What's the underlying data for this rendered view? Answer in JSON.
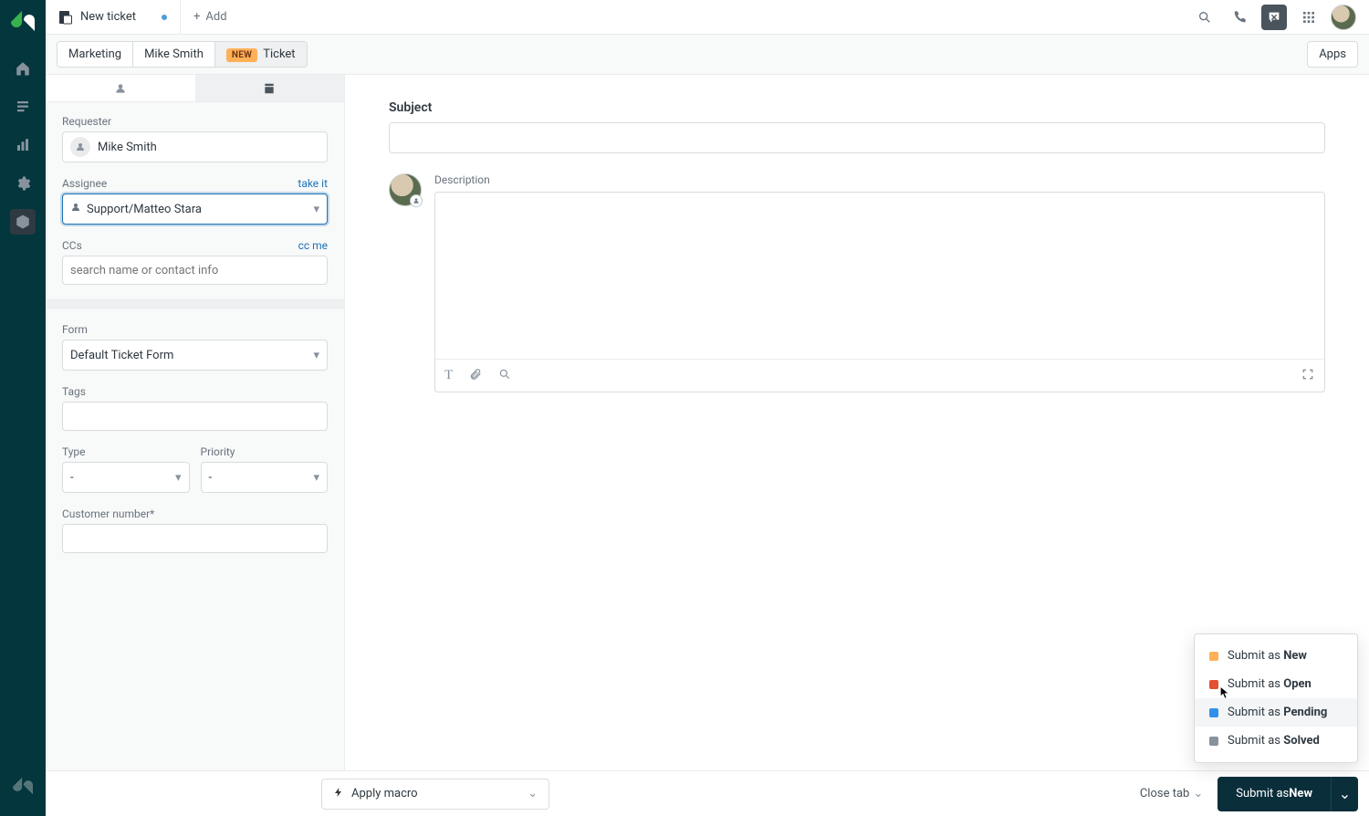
{
  "tabs": {
    "new_ticket_label": "New ticket",
    "add_label": "Add"
  },
  "breadcrumb": {
    "org": "Marketing",
    "user": "Mike Smith",
    "new_badge": "NEW",
    "ticket_label": "Ticket",
    "apps_btn": "Apps"
  },
  "sidebar": {
    "requester_label": "Requester",
    "requester_value": "Mike Smith",
    "assignee_label": "Assignee",
    "assignee_link": "take it",
    "assignee_value": "Support/Matteo Stara",
    "ccs_label": "CCs",
    "ccs_link": "cc me",
    "ccs_placeholder": "search name or contact info",
    "form_label": "Form",
    "form_value": "Default Ticket Form",
    "tags_label": "Tags",
    "type_label": "Type",
    "type_value": "-",
    "priority_label": "Priority",
    "priority_value": "-",
    "customer_number_label": "Customer number*"
  },
  "editor": {
    "subject_label": "Subject",
    "description_label": "Description"
  },
  "bottom": {
    "apply_macro": "Apply macro",
    "close_tab": "Close tab",
    "submit_prefix": "Submit as ",
    "submit_status": "New"
  },
  "submit_menu": {
    "prefix": "Submit as ",
    "new": "New",
    "open": "Open",
    "pending": "Pending",
    "solved": "Solved"
  }
}
